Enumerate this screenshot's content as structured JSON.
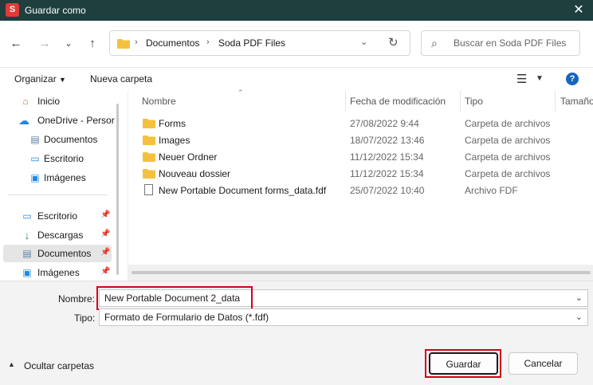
{
  "window": {
    "title": "Guardar como",
    "app_icon": "S"
  },
  "nav": {
    "path": [
      "Documentos",
      "Soda PDF Files"
    ],
    "search_placeholder": "Buscar en Soda PDF Files"
  },
  "toolbar": {
    "organize": "Organizar",
    "new_folder": "Nueva carpeta",
    "help": "?"
  },
  "sidebar": {
    "items": [
      {
        "label": "Inicio"
      },
      {
        "label": "OneDrive - Persor"
      },
      {
        "label": "Documentos"
      },
      {
        "label": "Escritorio"
      },
      {
        "label": "Imágenes"
      },
      {
        "label": "Escritorio"
      },
      {
        "label": "Descargas"
      },
      {
        "label": "Documentos"
      },
      {
        "label": "Imágenes"
      }
    ]
  },
  "columns": {
    "name": "Nombre",
    "date": "Fecha de modificación",
    "type": "Tipo",
    "size": "Tamaño"
  },
  "files": [
    {
      "name": "Forms",
      "date": "27/08/2022 9:44",
      "type": "Carpeta de archivos"
    },
    {
      "name": "Images",
      "date": "18/07/2022 13:46",
      "type": "Carpeta de archivos"
    },
    {
      "name": "Neuer Ordner",
      "date": "11/12/2022 15:34",
      "type": "Carpeta de archivos"
    },
    {
      "name": "Nouveau dossier",
      "date": "11/12/2022 15:34",
      "type": "Carpeta de archivos"
    },
    {
      "name": "New Portable Document forms_data.fdf",
      "date": "25/07/2022 10:40",
      "type": "Archivo FDF"
    }
  ],
  "form": {
    "name_label": "Nombre:",
    "name_value": "New Portable Document 2_data",
    "type_label": "Tipo:",
    "type_value": "Formato de Formulario de Datos (*.fdf)",
    "hide_folders": "Ocultar carpetas",
    "save": "Guardar",
    "cancel": "Cancelar"
  },
  "colors": {
    "titlebar": "#1f3f3f",
    "highlight": "#d0021b",
    "folder": "#f5c13d"
  }
}
